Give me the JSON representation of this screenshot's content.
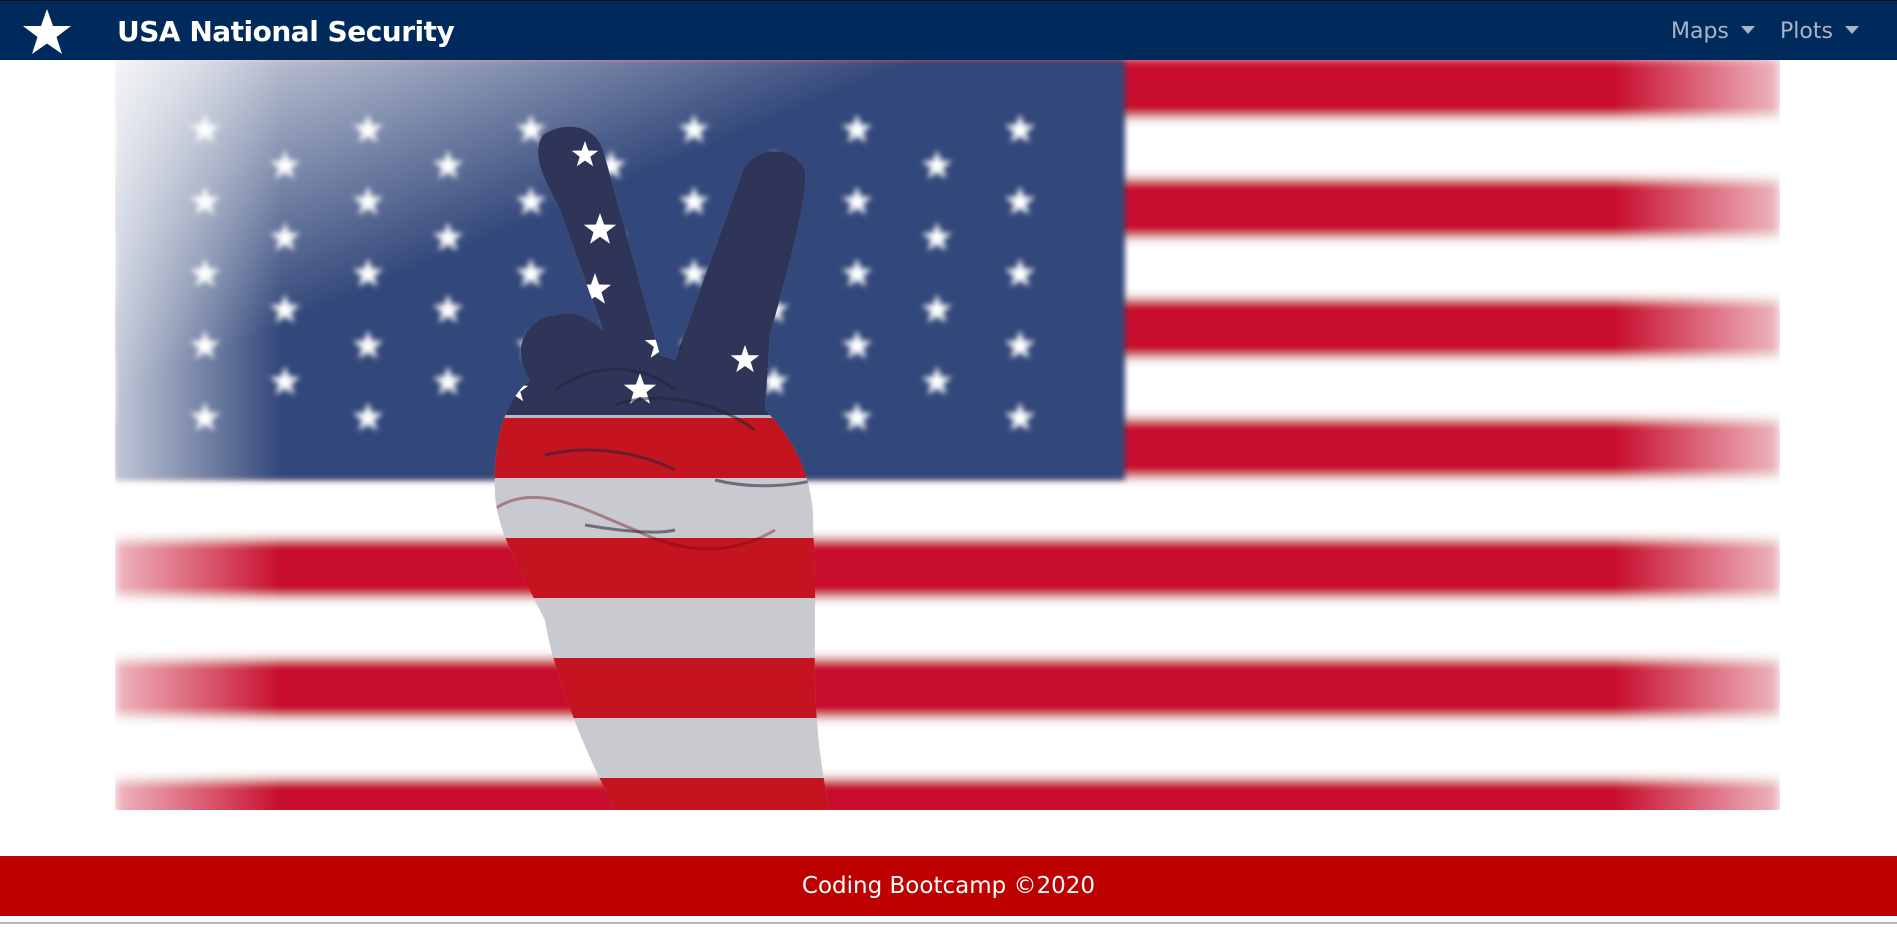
{
  "navbar": {
    "logo_icon": "star-icon",
    "title": "USA National Security",
    "menus": [
      {
        "label": "Maps",
        "icon": "caret-down-icon"
      },
      {
        "label": "Plots",
        "icon": "caret-down-icon"
      }
    ]
  },
  "hero": {
    "description": "American flag with hand making peace sign",
    "colors": {
      "blue": "#3b4b78",
      "red": "#c8102e",
      "white": "#ffffff"
    }
  },
  "footer": {
    "text": "Coding Bootcamp ©2020"
  },
  "colors": {
    "navbar_bg": "#002a5c",
    "footer_bg": "#bd0000",
    "nav_link": "#a9b4c4"
  }
}
